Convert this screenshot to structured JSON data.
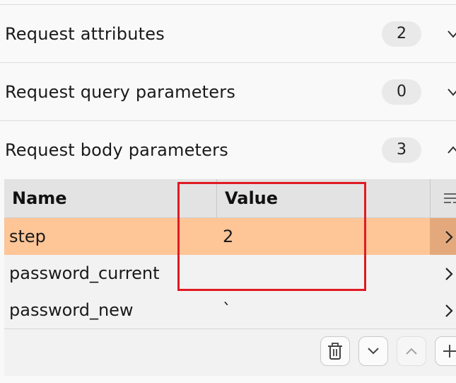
{
  "sections": [
    {
      "title": "Request attributes",
      "count": "2",
      "expanded": false
    },
    {
      "title": "Request query parameters",
      "count": "0",
      "expanded": false
    },
    {
      "title": "Request body parameters",
      "count": "3",
      "expanded": true
    }
  ],
  "table": {
    "columns": [
      "Name",
      "Value"
    ],
    "rows": [
      {
        "name": "step",
        "value": "2",
        "selected": true
      },
      {
        "name": "password_current",
        "value": "",
        "selected": false
      },
      {
        "name": "password_new",
        "value": "`",
        "selected": false
      }
    ]
  },
  "toolbar": {
    "buttons": [
      "delete",
      "move-down",
      "move-up",
      "add"
    ]
  },
  "colors": {
    "selected_row": "#fec597",
    "highlight": "#e01a22"
  }
}
